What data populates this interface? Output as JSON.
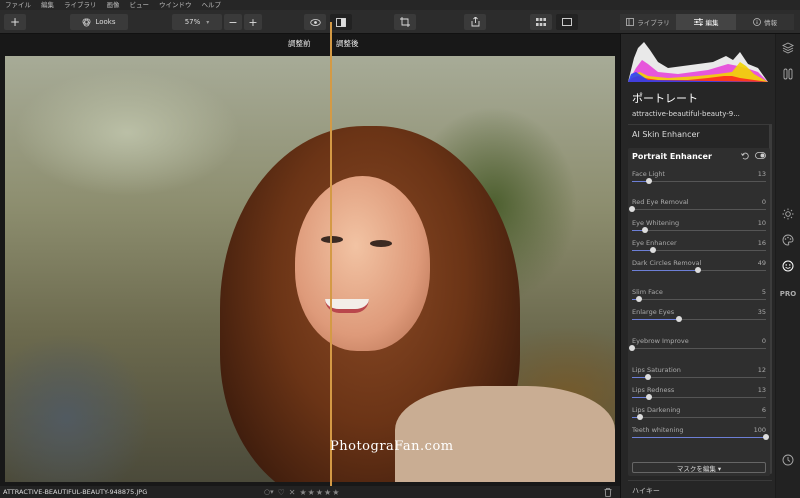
{
  "menu": [
    "ファイル",
    "編集",
    "ライブラリ",
    "画像",
    "ビュー",
    "ウインドウ",
    "ヘルプ"
  ],
  "toolbar": {
    "looks_label": "Looks",
    "zoom_value": "57%"
  },
  "tabs": {
    "library": "ライブラリ",
    "edit": "編集",
    "info": "情報"
  },
  "compare": {
    "before": "調整前",
    "after": "調整後"
  },
  "watermark": "PhotograFan.com",
  "status": {
    "filename": "ATTRACTIVE-BEAUTIFUL-BEAUTY-948875.JPG",
    "stars": "★★★★★"
  },
  "panel": {
    "title": "ポートレート",
    "file": "attractive-beautiful-beauty-9...",
    "section_skin": "AI Skin Enhancer",
    "section_portrait": "Portrait Enhancer",
    "mask_button": "マスクを編集 ▾",
    "hikey": "ハイキー",
    "sliders": [
      {
        "label": "Face Light",
        "value": "13",
        "level": 13
      },
      {
        "label": "Red Eye Removal",
        "value": "0",
        "level": 0
      },
      {
        "label": "Eye Whitening",
        "value": "10",
        "level": 10
      },
      {
        "label": "Eye Enhancer",
        "value": "16",
        "level": 16
      },
      {
        "label": "Dark Circles Removal",
        "value": "49",
        "level": 49
      },
      {
        "label": "Slim Face",
        "value": "5",
        "level": 5
      },
      {
        "label": "Enlarge Eyes",
        "value": "35",
        "level": 35
      },
      {
        "label": "Eyebrow Improve",
        "value": "0",
        "level": 0
      },
      {
        "label": "Lips Saturation",
        "value": "12",
        "level": 12
      },
      {
        "label": "Lips Redness",
        "value": "13",
        "level": 13
      },
      {
        "label": "Lips Darkening",
        "value": "6",
        "level": 6
      },
      {
        "label": "Teeth whitening",
        "value": "100",
        "level": 100
      }
    ]
  },
  "colors": {
    "accent": "#6d7fd6",
    "divider": "#d49a45"
  }
}
